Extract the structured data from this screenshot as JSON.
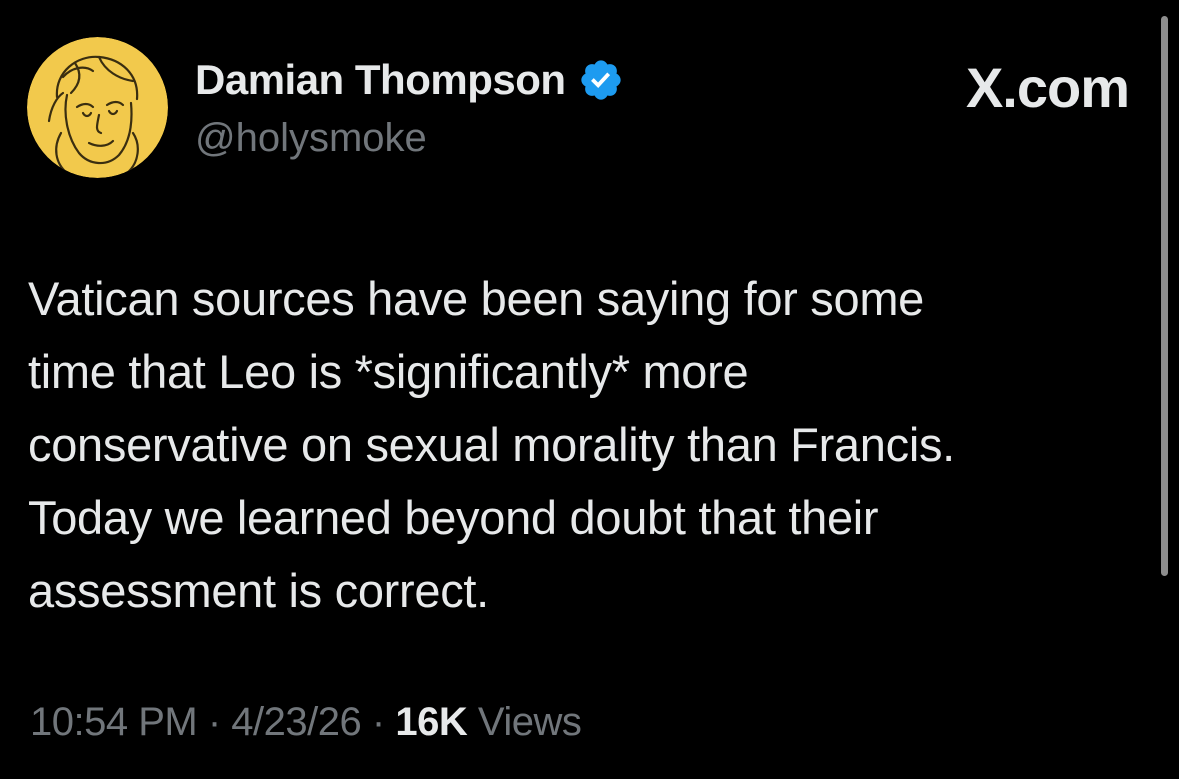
{
  "author": {
    "display_name": "Damian Thompson",
    "handle": "@holysmoke",
    "verified": true,
    "avatar_icon": "cartoon-portrait-avatar",
    "avatar_bg": "#f2c94c",
    "badge_color": "#1d9bf0"
  },
  "brand": {
    "label": "X.com"
  },
  "tweet": {
    "lines": [
      "Vatican sources have been saying for some",
      "time that Leo is *significantly* more",
      "conservative on sexual morality than Francis.",
      "Today we learned beyond doubt that their",
      "assessment is correct."
    ]
  },
  "meta": {
    "time": "10:54 PM",
    "date": "4/23/26",
    "separator": "·",
    "views_count": "16K",
    "views_label": "Views"
  },
  "colors": {
    "background": "#000000",
    "primary_text": "#e7e9ea",
    "secondary_text": "#71767b"
  }
}
